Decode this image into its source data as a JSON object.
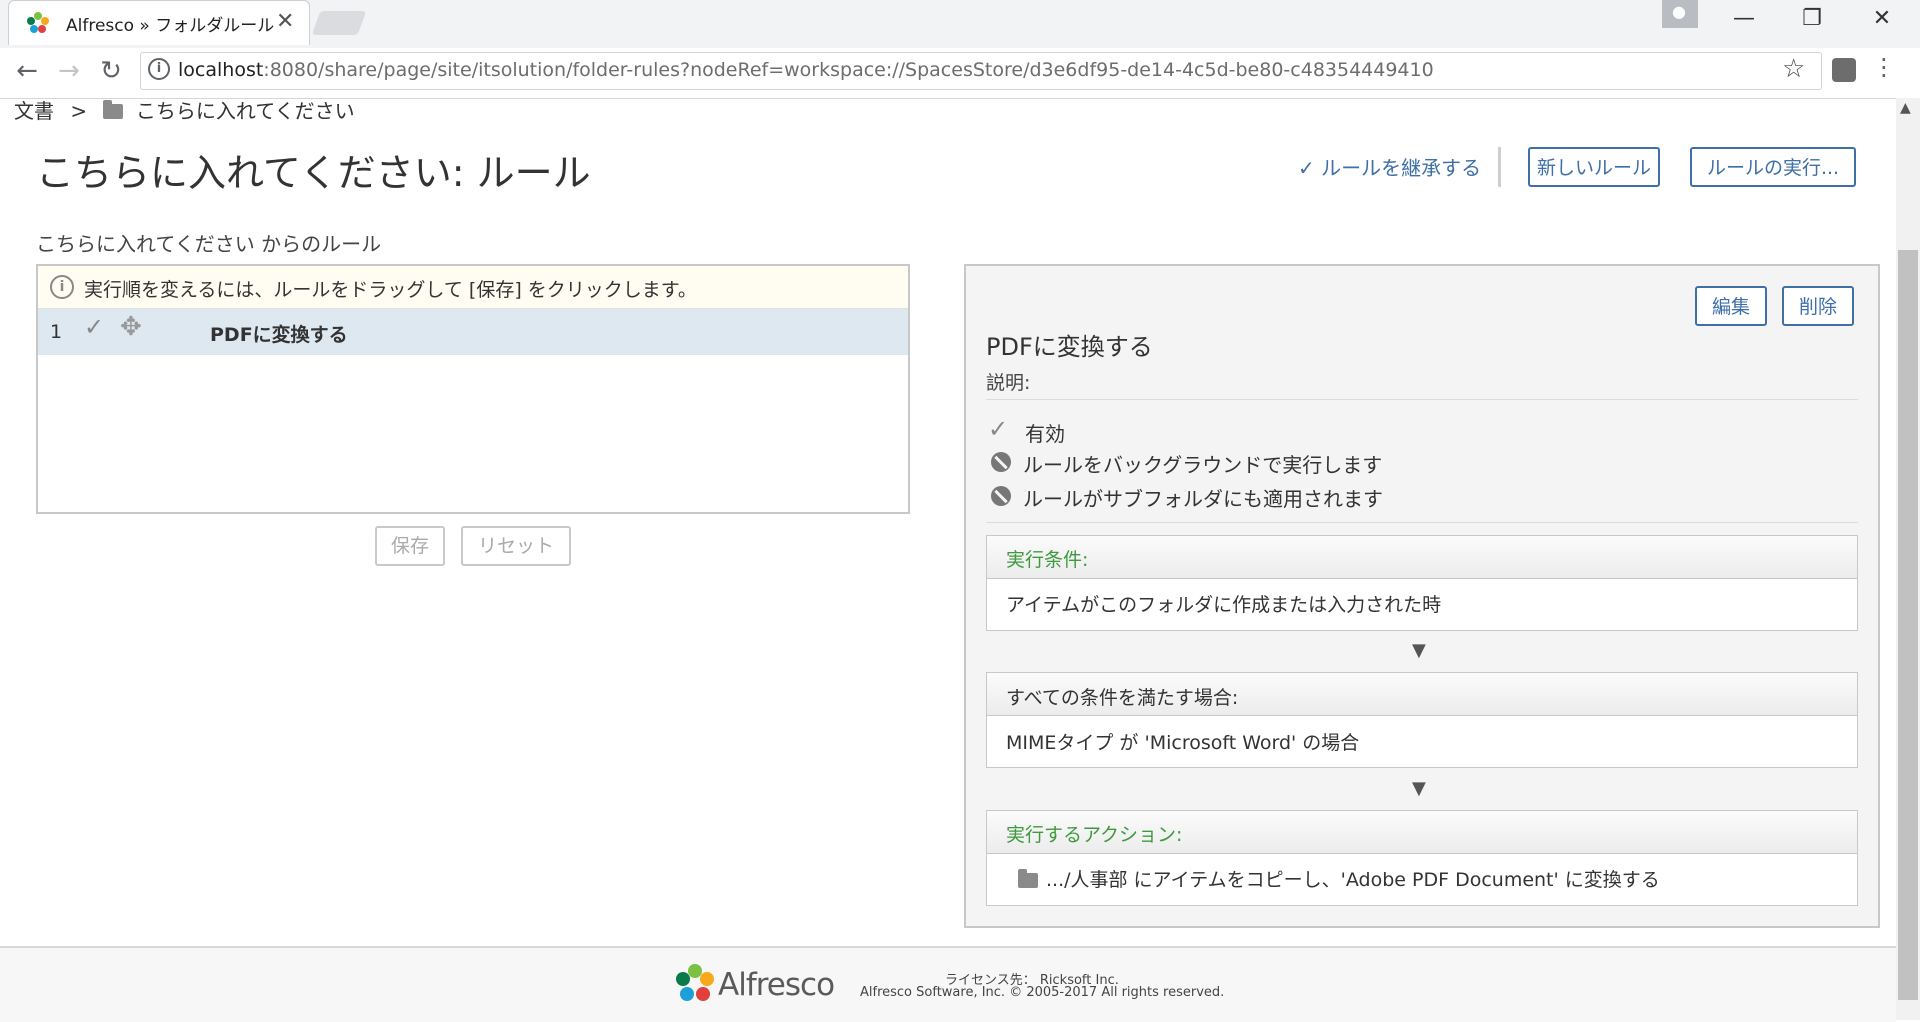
{
  "browser": {
    "tab_title": "Alfresco » フォルダルール",
    "tab_close": "✕",
    "url_host": "localhost",
    "url_path": ":8080/share/page/site/itsolution/folder-rules?nodeRef=workspace://SpacesStore/d3e6df95-de14-4c5d-be80-c48354449410",
    "nav_back": "←",
    "nav_forward": "→",
    "nav_reload": "↻",
    "star": "☆",
    "minimize": "—",
    "restore": "❐",
    "close": "✕"
  },
  "breadcrumb": {
    "root": "文書",
    "separator": ">",
    "current": "こちらに入れてください"
  },
  "header": {
    "title": "こちらに入れてください: ルール",
    "inherit_label": "ルールを継承する",
    "new_rule_label": "新しいルール",
    "run_rule_label": "ルールの実行..."
  },
  "rules_list": {
    "heading": "こちらに入れてください からのルール",
    "hint": "実行順を変えるには、ルールをドラッグして [保存] をクリックします。",
    "items": [
      {
        "index": "1",
        "name": "PDFに変換する"
      }
    ],
    "save_label": "保存",
    "reset_label": "リセット"
  },
  "rule_detail": {
    "edit_label": "編集",
    "delete_label": "削除",
    "name": "PDFに変換する",
    "description_label": "説明:",
    "flags": {
      "enabled": "有効",
      "background": "ルールをバックグラウンドで実行します",
      "subfolders": "ルールがサブフォルダにも適用されます"
    },
    "when": {
      "title": "実行条件:",
      "value": "アイテムがこのフォルダに作成または入力された時"
    },
    "if_all": {
      "title": "すべての条件を満たす場合:",
      "value": "MIMEタイプ が 'Microsoft Word' の場合"
    },
    "actions": {
      "title": "実行するアクション:",
      "value": ".../人事部 にアイテムをコピーし、'Adobe PDF Document' に変換する"
    },
    "arrow": "▼"
  },
  "footer": {
    "brand": "Alfresco",
    "license": "ライセンス先： Ricksoft Inc.",
    "copyright": "Alfresco Software, Inc. © 2005-2017 All rights reserved."
  },
  "icons": {
    "check": "✓",
    "drag": "✥",
    "info": "i"
  },
  "colors": {
    "accent_blue": "#3e6fa6",
    "section_green": "#3f9a3f",
    "selected_row": "#dde8f1"
  }
}
